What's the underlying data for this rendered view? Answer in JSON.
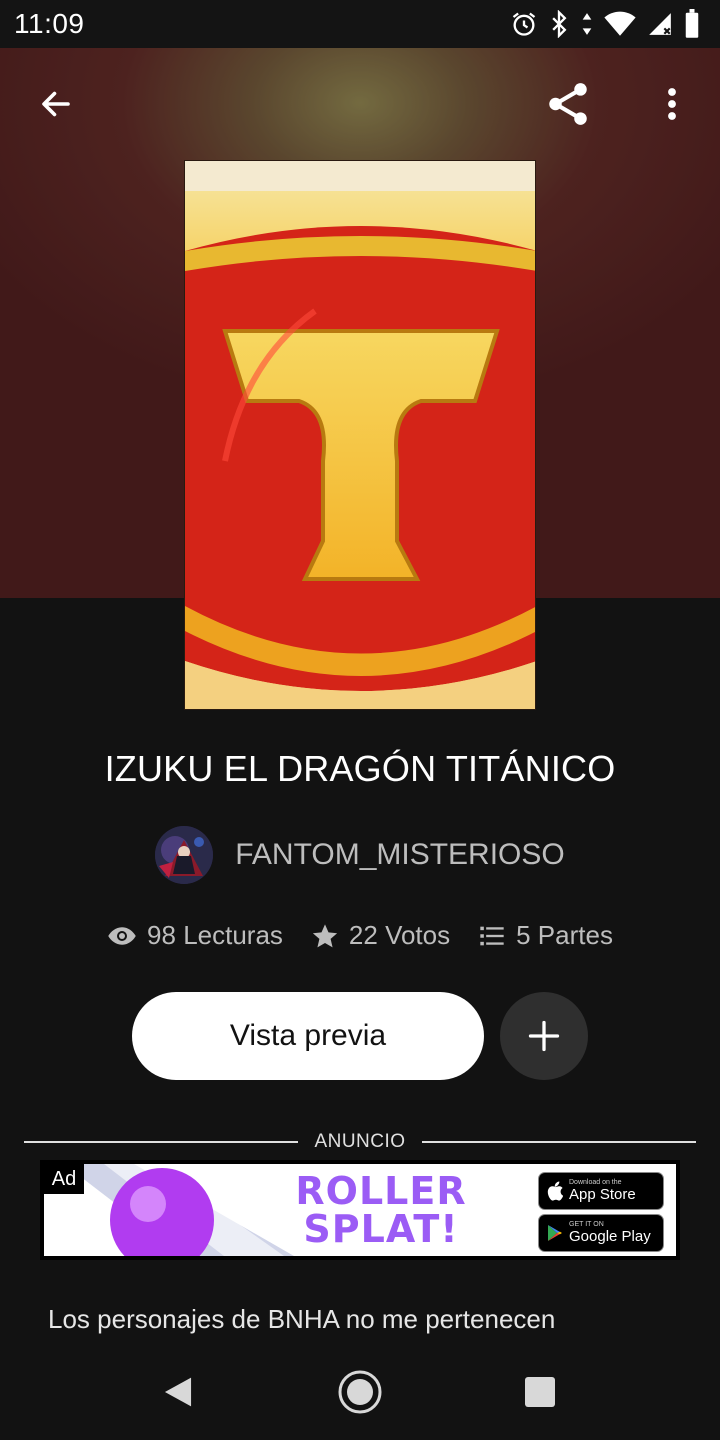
{
  "status_bar": {
    "time": "11:09"
  },
  "story": {
    "title": "IZUKU EL DRAGÓN TITÁNICO",
    "author": "FANTOM_MISTERIOSO",
    "stats": {
      "reads": "98 Lecturas",
      "votes": "22 Votos",
      "parts": "5 Partes"
    },
    "description": "Los personajes de BNHA no me pertenecen"
  },
  "actions": {
    "preview_label": "Vista previa"
  },
  "ad": {
    "section_label": "ANUNCIO",
    "badge": "Ad",
    "brand_line1": "ROLLER",
    "brand_line2": "SPLAT!",
    "app_store_small": "Download on the",
    "app_store_large": "App Store",
    "google_play_small": "GET IT ON",
    "google_play_large": "Google Play"
  },
  "icons": {
    "back": "arrow-left-icon",
    "share": "share-icon",
    "more": "more-vert-icon",
    "reads": "eye-icon",
    "votes": "star-icon",
    "parts": "list-icon",
    "add": "plus-icon"
  },
  "colors": {
    "background": "#121212",
    "button": "#ffffff",
    "ad_brand": "#9b5cf5"
  }
}
